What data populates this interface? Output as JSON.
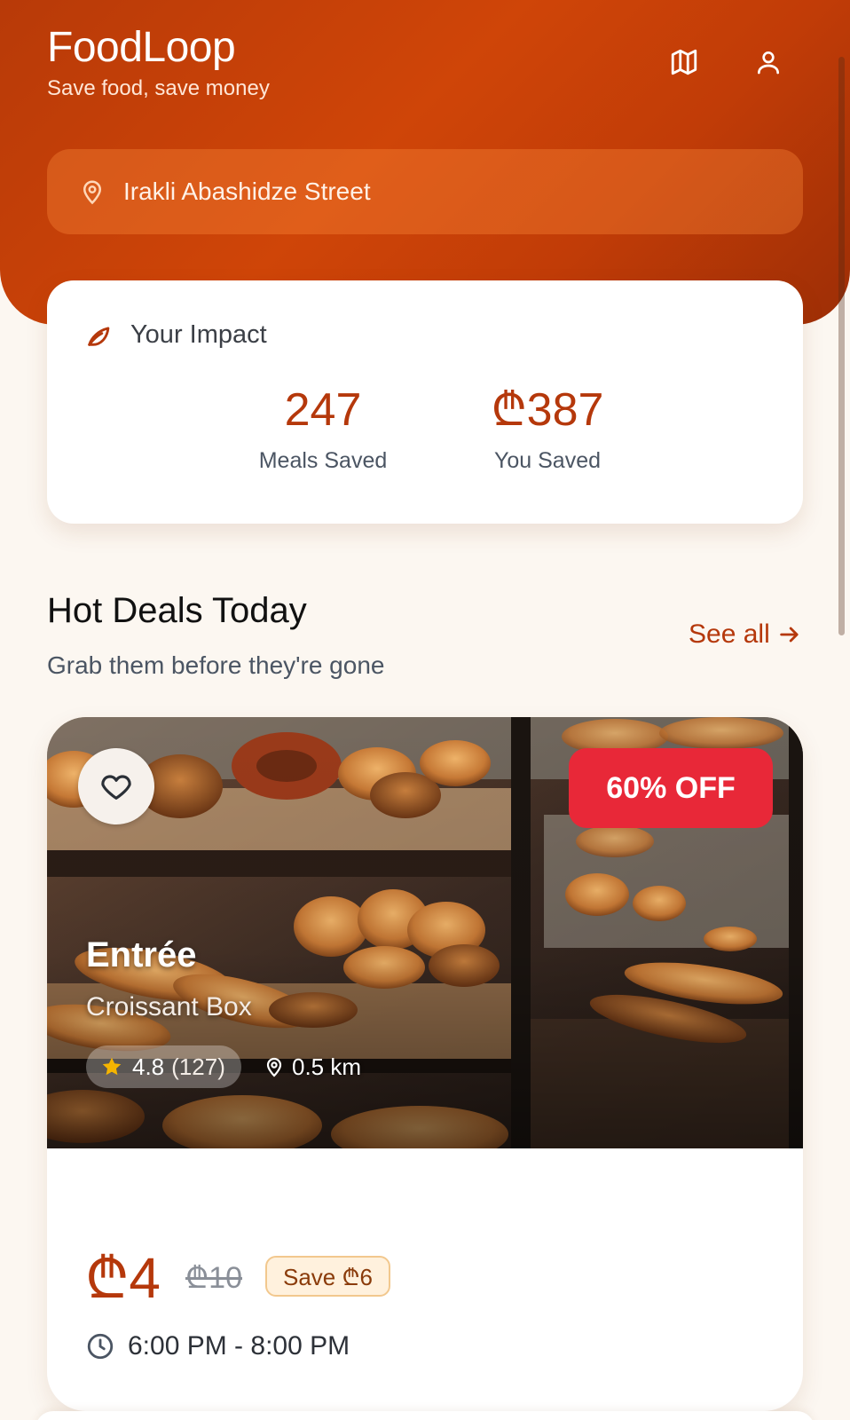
{
  "app": {
    "title": "FoodLoop",
    "tagline": "Save food, save money",
    "brand_color": "#c53e07"
  },
  "header": {
    "map_icon": "map-icon",
    "profile_icon": "user-icon",
    "location": {
      "icon": "map-pin-icon",
      "text": "Irakli Abashidze Street"
    }
  },
  "impact": {
    "icon": "leaf-icon",
    "title": "Your Impact",
    "stats": [
      {
        "value": "247",
        "label": "Meals Saved"
      },
      {
        "value": "₾387",
        "label": "You Saved"
      }
    ]
  },
  "hot_deals": {
    "title": "Hot Deals Today",
    "subtitle": "Grab them before they're gone",
    "see_all": "See all",
    "see_all_icon": "arrow-right-icon",
    "deals": [
      {
        "store": "Entrée",
        "item": "Croissant Box",
        "discount": "60% OFF",
        "discount_color": "#e82838",
        "rating": "4.8",
        "review_count": "(127)",
        "distance": "0.5 km",
        "price": "₾4",
        "original_price": "₾10",
        "savings": "Save ₾6",
        "pickup_time": "6:00 PM - 8:00 PM",
        "favorite_icon": "heart-icon",
        "rating_icon": "star-icon",
        "distance_icon": "map-pin-icon",
        "time_icon": "clock-icon"
      }
    ]
  }
}
